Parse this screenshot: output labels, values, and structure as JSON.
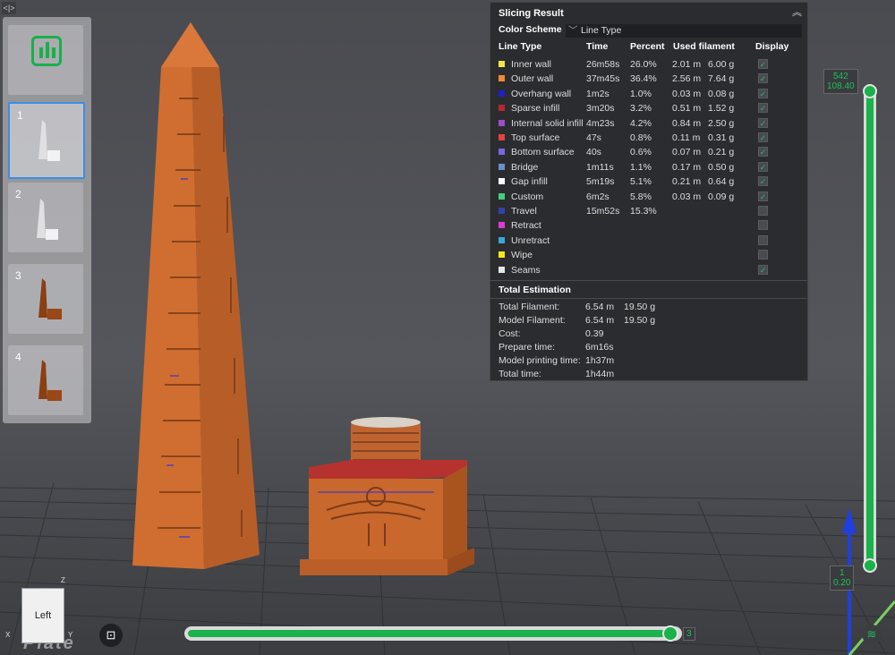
{
  "toolbar": {
    "toggle_icon": "<|>"
  },
  "thumbnails": [
    {
      "label": "",
      "type": "stats"
    },
    {
      "label": "1",
      "selected": true
    },
    {
      "label": "2"
    },
    {
      "label": "3"
    },
    {
      "label": "4"
    }
  ],
  "result": {
    "title": "Slicing Result",
    "color_scheme_label": "Color Scheme",
    "color_scheme_value": "Line Type",
    "headers": {
      "line_type": "Line Type",
      "time": "Time",
      "percent": "Percent",
      "used": "Used filament",
      "display": "Display"
    },
    "rows": [
      {
        "name": "Inner wall",
        "color": "#f2e64a",
        "time": "26m58s",
        "percent": "26.0%",
        "meters": "2.01 m",
        "grams": "6.00 g",
        "checked": true
      },
      {
        "name": "Outer wall",
        "color": "#f08a30",
        "time": "37m45s",
        "percent": "36.4%",
        "meters": "2.56 m",
        "grams": "7.64 g",
        "checked": true
      },
      {
        "name": "Overhang wall",
        "color": "#2020c8",
        "time": "1m2s",
        "percent": "1.0%",
        "meters": "0.03 m",
        "grams": "0.08 g",
        "checked": true
      },
      {
        "name": "Sparse infill",
        "color": "#b3282e",
        "time": "3m20s",
        "percent": "3.2%",
        "meters": "0.51 m",
        "grams": "1.52 g",
        "checked": true
      },
      {
        "name": "Internal solid infill",
        "color": "#9a4ec8",
        "time": "4m23s",
        "percent": "4.2%",
        "meters": "0.84 m",
        "grams": "2.50 g",
        "checked": true
      },
      {
        "name": "Top surface",
        "color": "#e8413c",
        "time": "47s",
        "percent": "0.8%",
        "meters": "0.11 m",
        "grams": "0.31 g",
        "checked": true
      },
      {
        "name": "Bottom surface",
        "color": "#7a66e0",
        "time": "40s",
        "percent": "0.6%",
        "meters": "0.07 m",
        "grams": "0.21 g",
        "checked": true
      },
      {
        "name": "Bridge",
        "color": "#6a90c4",
        "time": "1m11s",
        "percent": "1.1%",
        "meters": "0.17 m",
        "grams": "0.50 g",
        "checked": true
      },
      {
        "name": "Gap infill",
        "color": "#ffffff",
        "time": "5m19s",
        "percent": "5.1%",
        "meters": "0.21 m",
        "grams": "0.64 g",
        "checked": true
      },
      {
        "name": "Custom",
        "color": "#44d07a",
        "time": "6m2s",
        "percent": "5.8%",
        "meters": "0.03 m",
        "grams": "0.09 g",
        "checked": true
      },
      {
        "name": "Travel",
        "color": "#2f44a8",
        "time": "15m52s",
        "percent": "15.3%",
        "meters": "",
        "grams": "",
        "checked": false
      },
      {
        "name": "Retract",
        "color": "#d83ed0",
        "time": "",
        "percent": "",
        "meters": "",
        "grams": "",
        "checked": false
      },
      {
        "name": "Unretract",
        "color": "#3aa6d8",
        "time": "",
        "percent": "",
        "meters": "",
        "grams": "",
        "checked": false
      },
      {
        "name": "Wipe",
        "color": "#f5e61e",
        "time": "",
        "percent": "",
        "meters": "",
        "grams": "",
        "checked": false
      },
      {
        "name": "Seams",
        "color": "#e6e6e6",
        "time": "",
        "percent": "",
        "meters": "",
        "grams": "",
        "checked": true
      }
    ],
    "total_title": "Total Estimation",
    "totals": [
      {
        "label": "Total Filament:",
        "v1": "6.54 m",
        "v2": "19.50 g"
      },
      {
        "label": "Model Filament:",
        "v1": "6.54 m",
        "v2": "19.50 g"
      },
      {
        "label": "Cost:",
        "v1": "0.39",
        "v2": ""
      },
      {
        "label": "Prepare time:",
        "v1": "6m16s",
        "v2": ""
      },
      {
        "label": "Model printing time:",
        "v1": "1h37m",
        "v2": ""
      },
      {
        "label": "Total time:",
        "v1": "1h44m",
        "v2": ""
      }
    ]
  },
  "layer_slider": {
    "top_layer": "542",
    "top_height": "108.40",
    "bottom_layer": "1",
    "bottom_height": "0.20"
  },
  "move_slider": {
    "value": "3"
  },
  "viewcube": {
    "face": "Left",
    "z": "Z",
    "x": "X",
    "y": "Y"
  },
  "plate_text": "Plate",
  "colors": {
    "accent": "#19b24b",
    "model": "#c8682c",
    "panel": "#2b2c2f"
  }
}
